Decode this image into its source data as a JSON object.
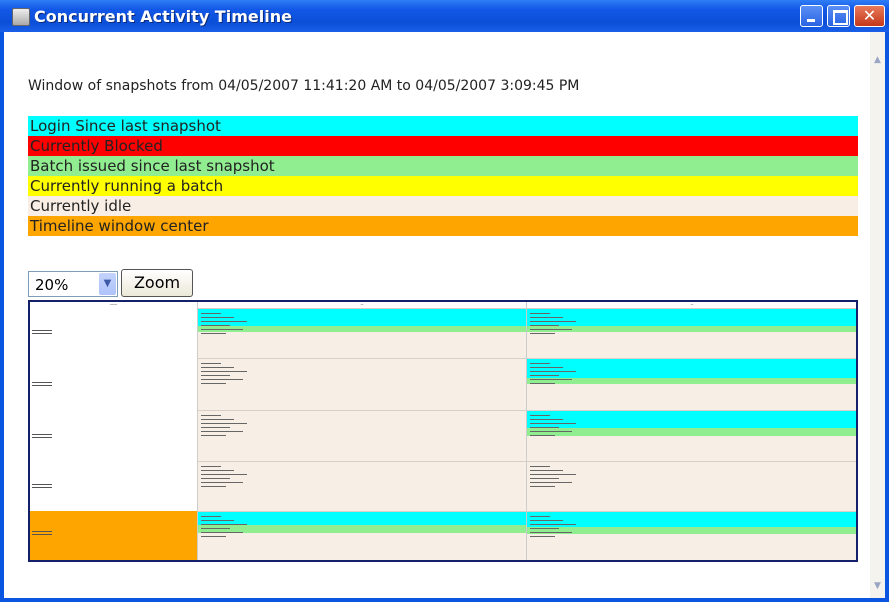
{
  "window": {
    "title": "Concurrent Activity Timeline"
  },
  "header": {
    "text": "Window of snapshots from 04/05/2007 11:41:20 AM to 04/05/2007 3:09:45 PM"
  },
  "legend": [
    {
      "label": "Login Since last snapshot",
      "color": "#00ffff"
    },
    {
      "label": "Currently Blocked",
      "color": "#ff0000"
    },
    {
      "label": "Batch issued since last snapshot",
      "color": "#90ee90"
    },
    {
      "label": "Currently running a batch",
      "color": "#ffff00"
    },
    {
      "label": "Currently idle",
      "color": "#f9eee6"
    },
    {
      "label": "Timeline window center",
      "color": "#ffa500"
    }
  ],
  "zoom": {
    "selected": "20%",
    "button_label": "Zoom"
  }
}
